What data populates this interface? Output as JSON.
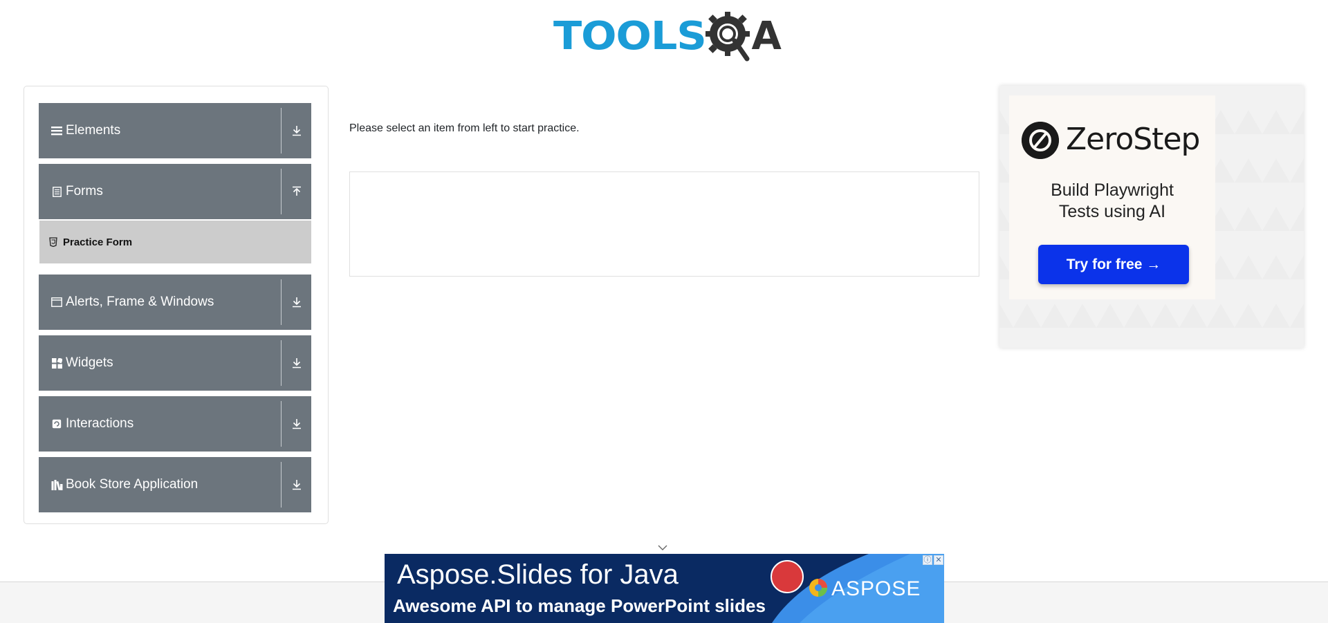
{
  "header": {
    "logo_tools": "TOOLS",
    "logo_q_icon": "gear-magnifier-icon",
    "logo_a": "A"
  },
  "sidebar": {
    "groups": [
      {
        "label": "Elements",
        "icon": "list-icon",
        "toggle": "download-arrow-icon",
        "expanded": false
      },
      {
        "label": "Forms",
        "icon": "form-doc-icon",
        "toggle": "upload-arrow-icon",
        "expanded": true
      },
      {
        "label": "Alerts, Frame & Windows",
        "icon": "window-icon",
        "toggle": "download-arrow-icon",
        "expanded": false
      },
      {
        "label": "Widgets",
        "icon": "widgets-icon",
        "toggle": "download-arrow-icon",
        "expanded": false
      },
      {
        "label": "Interactions",
        "icon": "interactions-icon",
        "toggle": "download-arrow-icon",
        "expanded": false
      },
      {
        "label": "Book Store Application",
        "icon": "books-icon",
        "toggle": "download-arrow-icon",
        "expanded": false
      }
    ],
    "sub_items": [
      {
        "label": "Practice Form",
        "icon": "html5-icon"
      }
    ]
  },
  "main": {
    "instruction": "Please select an item from left to start practice."
  },
  "right_ad": {
    "brand": "ZeroStep",
    "tagline_line1": "Build Playwright",
    "tagline_line2": "Tests using AI",
    "button_label": "Try for free →",
    "button_color": "#0b33ea"
  },
  "bottom_ad": {
    "title": "Aspose.Slides for Java",
    "subtitle": "Awesome API to manage PowerPoint  slides",
    "brand": "ASPOSE",
    "info_glyph": "ⓘ",
    "close_glyph": "✕"
  },
  "colors": {
    "sidebar_group_bg": "#6c757d",
    "sub_item_bg": "#cccccc",
    "logo_blue": "#1b9cd7",
    "logo_dark": "#333333"
  }
}
